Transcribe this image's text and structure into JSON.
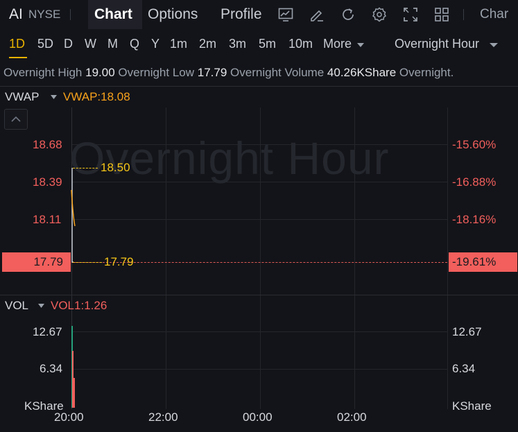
{
  "header": {
    "symbol": "AI",
    "exchange": "NYSE",
    "tabs": [
      "Chart",
      "Options",
      "Profile"
    ],
    "active_tab": "Chart",
    "cut_off_label": "Char"
  },
  "periods": [
    "1D",
    "5D",
    "D",
    "W",
    "M",
    "Q",
    "Y",
    "1m",
    "2m",
    "3m",
    "5m",
    "10m"
  ],
  "active_period": "1D",
  "more_label": "More",
  "session_select": "Overnight Hour",
  "info": {
    "high_label": "Overnight High",
    "high_value": "19.00",
    "low_label": "Overnight Low",
    "low_value": "17.79",
    "volume_label": "Overnight Volume",
    "volume_value": "40.26KShare",
    "trailing": "Overnight."
  },
  "price_panel": {
    "indicator": "VWAP",
    "indicator_value": "VWAP:18.08",
    "watermark": "Overnight Hour",
    "y_left": [
      "18.68",
      "18.39",
      "18.11"
    ],
    "y_right": [
      "-15.60%",
      "-16.88%",
      "-18.16%"
    ],
    "current_left": "17.79",
    "current_right": "-19.61%",
    "annot_high": "18.50",
    "annot_low": "17.79"
  },
  "volume_panel": {
    "indicator": "VOL",
    "indicator_value": "VOL1:1.26",
    "y_left": [
      "12.67",
      "6.34",
      "KShare"
    ],
    "y_right": [
      "12.67",
      "6.34",
      "KShare"
    ]
  },
  "x_axis": [
    "20:00",
    "22:00",
    "00:00",
    "02:00"
  ],
  "colors": {
    "background": "#131419",
    "accent": "#e9b200",
    "down_red": "#f25f5c",
    "vwap_orange": "#f7a21b",
    "up_green": "#26a17b"
  },
  "chart_data": {
    "type": "line",
    "price_series": [
      {
        "x": "20:00",
        "y": 18.5
      },
      {
        "x": "20:00",
        "y": 17.79
      }
    ],
    "vwap_series": [
      {
        "x": "20:00",
        "y": 18.45
      },
      {
        "x": "20:01",
        "y": 18.15
      }
    ],
    "volume_bars": [
      {
        "x": "20:00",
        "value": 13.0,
        "color": "green"
      },
      {
        "x": "20:00",
        "value": 9.0,
        "color": "red"
      },
      {
        "x": "20:01",
        "value": 4.8,
        "color": "red"
      }
    ],
    "ylim_price": [
      17.68,
      19.0
    ],
    "ylim_volume": [
      0,
      14.0
    ],
    "xlim": [
      "20:00",
      "03:00"
    ]
  }
}
